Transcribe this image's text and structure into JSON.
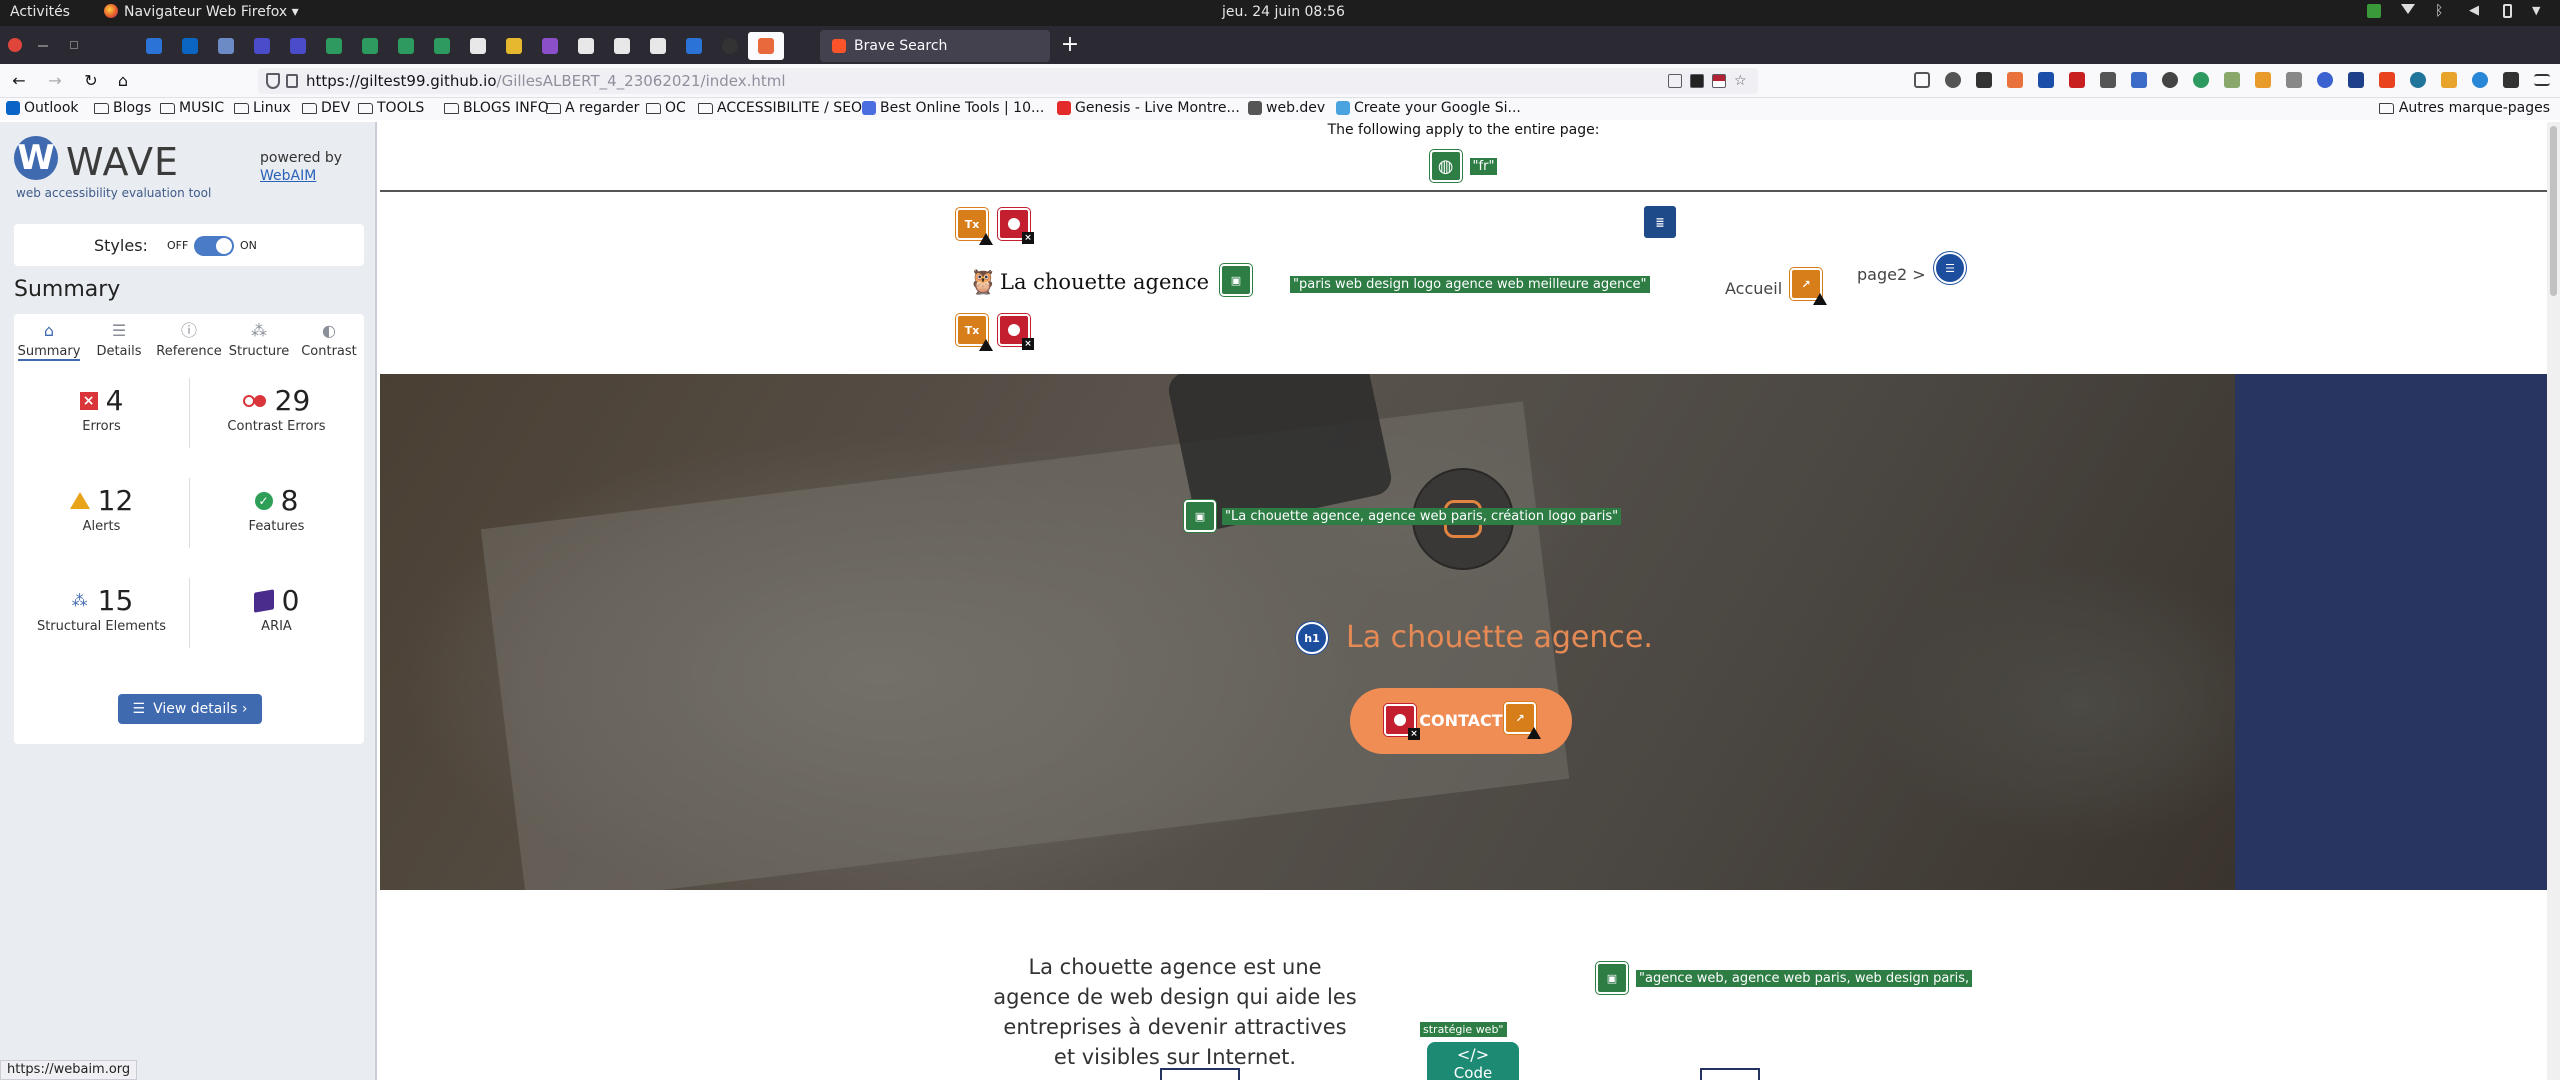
{
  "system": {
    "activities": "Activités",
    "app_menu": "Navigateur Web Firefox ▾",
    "clock": "jeu. 24 juin  08:56"
  },
  "browser": {
    "tab_active_title": "Brave Search",
    "url_host": "https://giltest99.github.io",
    "url_path": "/GillesALBERT_4_23062021/index.html",
    "bookmarks": [
      {
        "label": "Outlook",
        "type": "favicon",
        "color": "#0a64c8"
      },
      {
        "label": "Blogs",
        "type": "folder"
      },
      {
        "label": "MUSIC",
        "type": "folder"
      },
      {
        "label": "Linux",
        "type": "folder"
      },
      {
        "label": "DEV",
        "type": "folder"
      },
      {
        "label": "TOOLS",
        "type": "folder"
      },
      {
        "label": "BLOGS INFO",
        "type": "folder"
      },
      {
        "label": "A regarder",
        "type": "folder"
      },
      {
        "label": "OC",
        "type": "folder"
      },
      {
        "label": "ACCESSIBILITE / SEO",
        "type": "folder"
      },
      {
        "label": "Best Online Tools | 10...",
        "type": "favicon",
        "color": "#4a6ee0"
      },
      {
        "label": "Genesis - Live Montre...",
        "type": "favicon",
        "color": "#e32b2b"
      },
      {
        "label": "web.dev",
        "type": "favicon",
        "color": "#555555"
      },
      {
        "label": "Create your Google Si...",
        "type": "favicon",
        "color": "#4aa3df"
      }
    ],
    "other_bookmarks": "Autres marque-pages",
    "status_url": "https://webaim.org"
  },
  "wave": {
    "brand": "WAVE",
    "tagline": "web accessibility evaluation tool",
    "powered_by": "powered by",
    "webaim": "WebAIM",
    "styles_label": "Styles:",
    "styles_off": "OFF",
    "styles_on": "ON",
    "styles_enabled": true,
    "summary_title": "Summary",
    "tabs": [
      {
        "label": "Summary",
        "icon": "home-icon",
        "glyph": "⌂"
      },
      {
        "label": "Details",
        "icon": "list-icon",
        "glyph": "☰"
      },
      {
        "label": "Reference",
        "icon": "info-icon",
        "glyph": "ⓘ"
      },
      {
        "label": "Structure",
        "icon": "structure-icon",
        "glyph": "⁂"
      },
      {
        "label": "Contrast",
        "icon": "contrast-icon",
        "glyph": "◐"
      }
    ],
    "stats": {
      "errors": {
        "value": "4",
        "label": "Errors"
      },
      "contrast_errors": {
        "value": "29",
        "label": "Contrast Errors"
      },
      "alerts": {
        "value": "12",
        "label": "Alerts"
      },
      "features": {
        "value": "8",
        "label": "Features"
      },
      "structural": {
        "value": "15",
        "label": "Structural Elements"
      },
      "aria": {
        "value": "0",
        "label": "ARIA"
      }
    },
    "view_details": "View details ›"
  },
  "page": {
    "note": "The following apply to the entire page:",
    "lang_tag": "\"fr\"",
    "logo_alt": "\"paris web design logo agence web meilleure agence\"",
    "brand_name": "La chouette agence",
    "nav_home": "Accueil",
    "nav_page2": "page2 >",
    "hero_alt": "\"La chouette agence, agence web paris, création logo paris\"",
    "hero_title": "La chouette agence.",
    "h1_badge": "h1",
    "contact": "CONTACT",
    "intro": "La chouette agence est une agence de web design qui aide les entreprises à devenir attractives et visibles sur Internet.",
    "intro_alt": "\"agence web, agence web paris, web design paris,",
    "strategy_alt": "stratégie web\"",
    "code_label": "Code",
    "code_glyph": "</>",
    "badge_text": "Tx"
  }
}
